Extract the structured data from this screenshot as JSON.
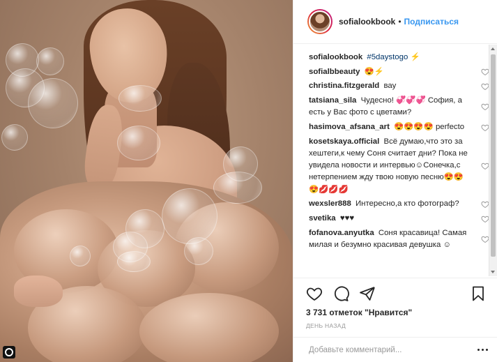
{
  "post": {
    "username": "sofialookbook",
    "separator": "•",
    "follow_label": "Подписаться"
  },
  "caption": {
    "username": "sofialookbook",
    "hashtag": "#5daystogo",
    "emoji": "⚡"
  },
  "comments": [
    {
      "username": "sofialbbeauty",
      "text": "😍⚡"
    },
    {
      "username": "christina.fitzgerald",
      "text": "вау"
    },
    {
      "username": "tatsiana_sila",
      "text": "Чудесно! 💞💞💞 София, а есть у Вас фото с цветами?"
    },
    {
      "username": "hasimova_afsana_art",
      "text": "😍😍😍😍 perfecto"
    },
    {
      "username": "kosetskaya.official",
      "text": "Всё думаю,что это за хештеги,к чему Соня считает дни? Пока не увидела новости и интервью☺Сонечка,с нетерпением жду твою новую песню😍😍😍💋💋💋"
    },
    {
      "username": "wexsler888",
      "text": "Интересно,а кто фотограф?"
    },
    {
      "username": "svetika",
      "text": "♥♥♥"
    },
    {
      "username": "fofanova.anyutka",
      "text": "Соня красавица! Самая милая и безумно красивая девушка ☺"
    }
  ],
  "likes_text": "3 731 отметок \"Нравится\"",
  "timestamp": "ДЕНЬ НАЗАД",
  "add_comment_placeholder": "Добавьте комментарий...",
  "colors": {
    "link_blue": "#3897f0",
    "hashtag_blue": "#003569",
    "text": "#262626",
    "muted": "#999999",
    "border": "#efefef"
  },
  "icons": {
    "like": "heart-icon",
    "comment": "comment-bubble-icon",
    "share": "paper-plane-icon",
    "save": "bookmark-icon",
    "more": "more-options-icon"
  }
}
